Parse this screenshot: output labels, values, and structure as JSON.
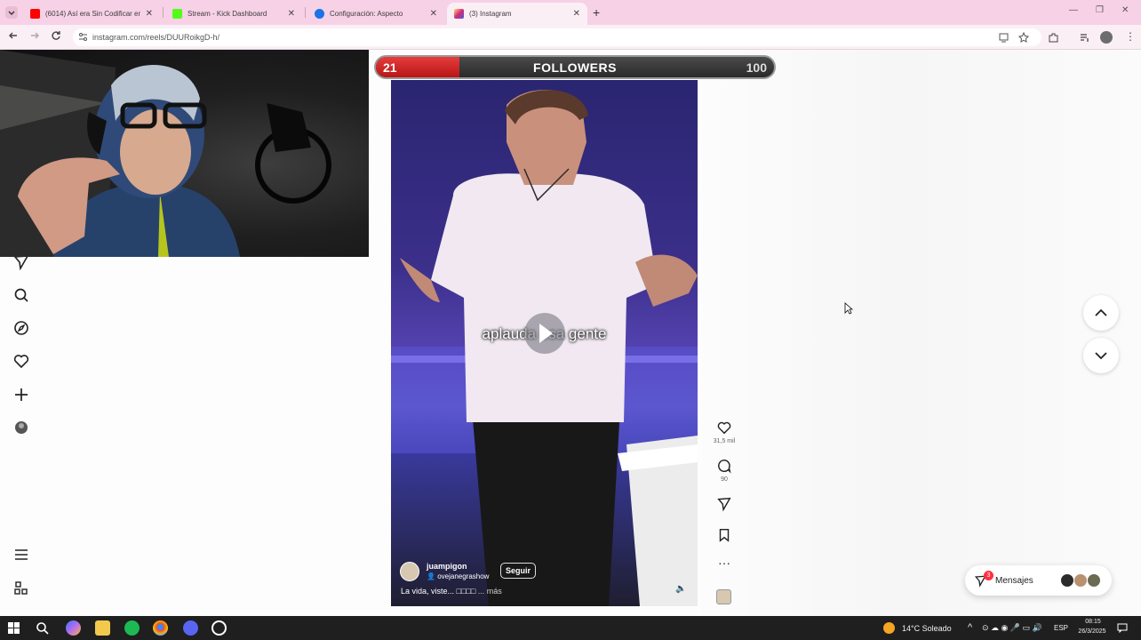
{
  "browser": {
    "tabs": [
      {
        "title": "(6014) Así era Sin Codificar en",
        "favicon_color": "#ff0000",
        "active": false
      },
      {
        "title": "Stream - Kick Dashboard",
        "favicon_color": "#53fc18",
        "active": false
      },
      {
        "title": "Configuración: Aspecto",
        "favicon_color": "#1a73e8",
        "active": false
      },
      {
        "title": "(3) Instagram",
        "favicon_color": "#e1306c",
        "active": true
      }
    ],
    "new_tab_label": "+",
    "url": "instagram.com/reels/DUURoikgD-h/"
  },
  "overlay": {
    "followers_current": "21",
    "followers_label": "FOLLOWERS",
    "followers_goal": "100",
    "progress_fraction": 0.21
  },
  "instagram": {
    "sidebar_icons": [
      "messenger-icon",
      "search-icon",
      "explore-icon",
      "heart-icon",
      "create-icon",
      "profile-avatar",
      "menu-icon",
      "more-icon"
    ],
    "reel": {
      "subtitle": "aplauda esa gente",
      "author": "juampigon",
      "author_sub": "ovejanegrashow",
      "follow_label": "Seguir",
      "caption": "La vida, viste... □□□□",
      "caption_more": "... más"
    },
    "actions": {
      "likes": "31,5 mil",
      "comments": "90"
    },
    "messages": {
      "label": "Mensajes",
      "badge": "3"
    }
  },
  "taskbar": {
    "weather": "14°C  Soleado",
    "language": "ESP",
    "time": "08:15",
    "date": "26/3/2025"
  }
}
